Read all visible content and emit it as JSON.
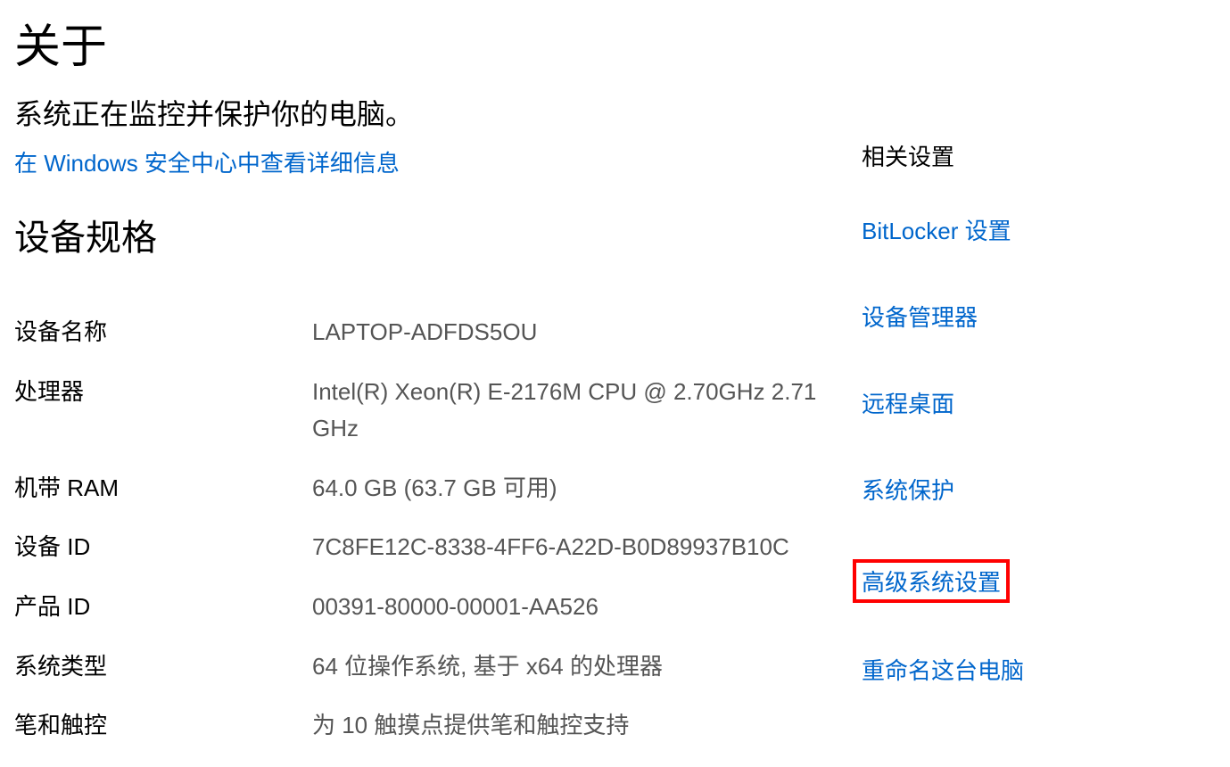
{
  "page": {
    "title": "关于",
    "subtitle": "系统正在监控并保护你的电脑。",
    "security_link": "在 Windows 安全中心中查看详细信息",
    "section_title": "设备规格"
  },
  "specs": {
    "device_name": {
      "label": "设备名称",
      "value": "LAPTOP-ADFDS5OU"
    },
    "processor": {
      "label": "处理器",
      "value": "Intel(R) Xeon(R) E-2176M  CPU @ 2.70GHz   2.71 GHz"
    },
    "ram": {
      "label": "机带 RAM",
      "value": "64.0 GB (63.7 GB 可用)"
    },
    "device_id": {
      "label": "设备 ID",
      "value": "7C8FE12C-8338-4FF6-A22D-B0D89937B10C"
    },
    "product_id": {
      "label": "产品 ID",
      "value": "00391-80000-00001-AA526"
    },
    "system_type": {
      "label": "系统类型",
      "value": "64 位操作系统, 基于 x64 的处理器"
    },
    "pen_touch": {
      "label": "笔和触控",
      "value": "为 10 触摸点提供笔和触控支持"
    }
  },
  "sidebar": {
    "title": "相关设置",
    "links": {
      "bitlocker": "BitLocker 设置",
      "device_manager": "设备管理器",
      "remote_desktop": "远程桌面",
      "system_protection": "系统保护",
      "advanced_settings": "高级系统设置",
      "rename_pc": "重命名这台电脑"
    }
  }
}
